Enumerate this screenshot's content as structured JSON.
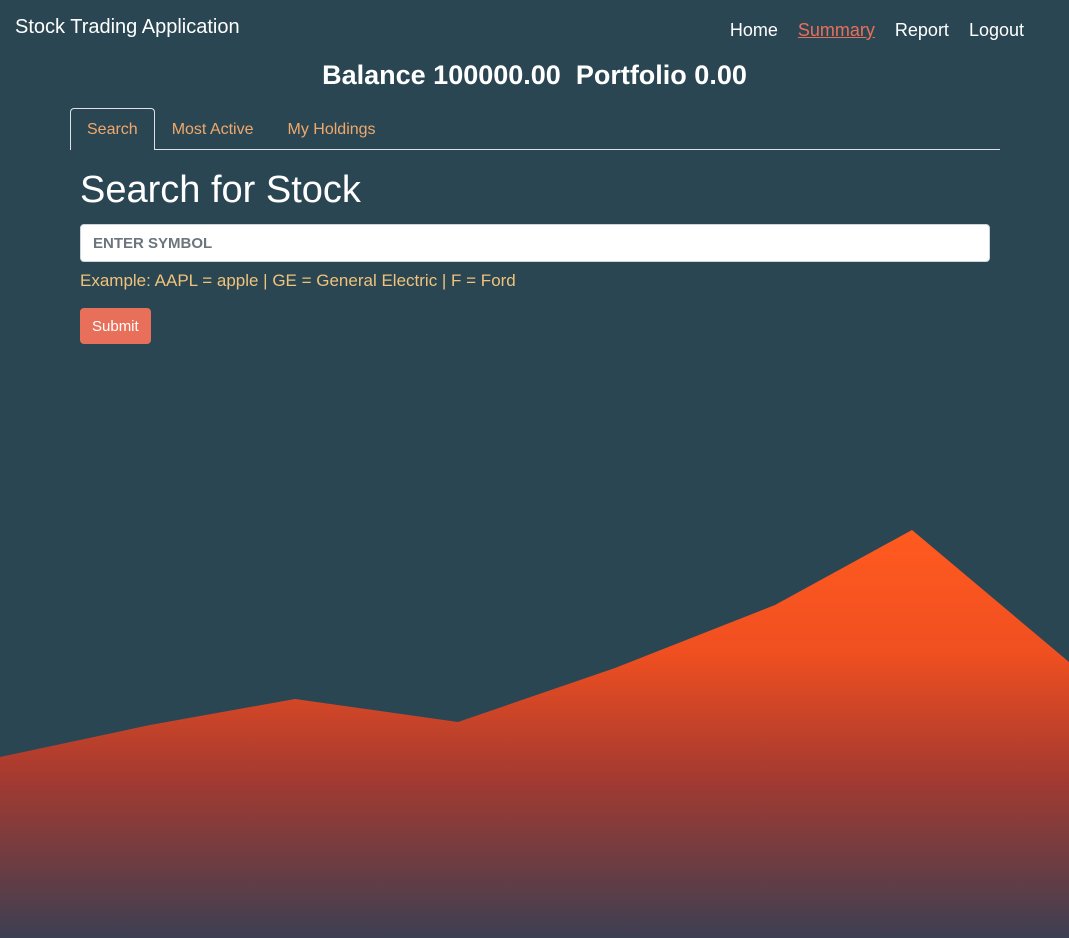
{
  "navbar": {
    "brand": "Stock Trading Application",
    "links": [
      {
        "label": "Home",
        "active": false
      },
      {
        "label": "Summary",
        "active": true
      },
      {
        "label": "Report",
        "active": false
      },
      {
        "label": "Logout",
        "active": false
      }
    ]
  },
  "account": {
    "balance_line": "Balance 100000.00  Portfolio 0.00"
  },
  "tabs": [
    {
      "label": "Search",
      "active": true
    },
    {
      "label": "Most Active",
      "active": false
    },
    {
      "label": "My Holdings",
      "active": false
    }
  ],
  "search": {
    "heading": "Search for Stock",
    "placeholder": "ENTER SYMBOL",
    "value": "",
    "example": "Example: AAPL = apple | GE = General Electric | F = Ford",
    "submit_label": "Submit"
  },
  "colors": {
    "background": "#2a4653",
    "accent": "#e8705a",
    "tab_text": "#f0a96b",
    "example_text": "#f0c27a",
    "mountain_top": "#ff5a1f",
    "mountain_bottom": "#3d3f52"
  }
}
